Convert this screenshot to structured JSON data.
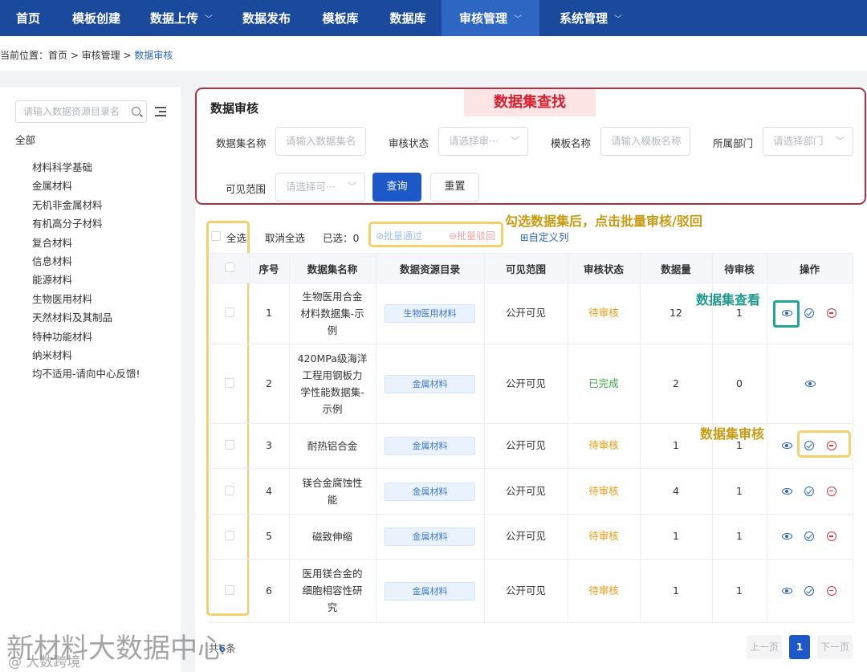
{
  "nav": {
    "items": [
      {
        "label": "首页",
        "chevron": false,
        "active": false
      },
      {
        "label": "模板创建",
        "chevron": false,
        "active": false
      },
      {
        "label": "数据上传",
        "chevron": true,
        "active": false
      },
      {
        "label": "数据发布",
        "chevron": false,
        "active": false
      },
      {
        "label": "模板库",
        "chevron": false,
        "active": false
      },
      {
        "label": "数据库",
        "chevron": false,
        "active": false
      },
      {
        "label": "审核管理",
        "chevron": true,
        "active": true
      },
      {
        "label": "系统管理",
        "chevron": true,
        "active": false
      }
    ]
  },
  "breadcrumb": {
    "prefix": "当前位置：首页 > 审核管理 > ",
    "current": "数据审核"
  },
  "sidebar": {
    "search_placeholder": "请输入数据资源目录名",
    "root": "全部",
    "items": [
      "材料科学基础",
      "金属材料",
      "无机非金属材料",
      "有机高分子材料",
      "复合材料",
      "信息材料",
      "能源材料",
      "生物医用材料",
      "天然材料及其制品",
      "特种功能材料",
      "纳米材料",
      "均不适用-请向中心反馈!"
    ]
  },
  "search": {
    "title": "数据审核",
    "banner": "数据集查找",
    "dataset_label": "数据集名称",
    "dataset_placeholder": "请输入数据集名",
    "status_label": "审核状态",
    "status_placeholder": "请选择审···",
    "template_label": "模板名称",
    "template_placeholder": "请输入模板名称",
    "dept_label": "所属部门",
    "dept_placeholder": "请选择部门",
    "scope_label": "可见范围",
    "scope_placeholder": "请选择可···",
    "query_label": "查询",
    "reset_label": "重置"
  },
  "toolbar": {
    "select_all": "全选",
    "deselect_all": "取消全选",
    "selected": "已选：0",
    "batch_approve": "⊘批量通过",
    "batch_reject": "⊖批量驳回",
    "custom_cols": "⊞自定义列"
  },
  "annotations": {
    "batch_hint": "勾选数据集后，点击批量审核/驳回",
    "view_hint": "数据集查看",
    "review_hint": "数据集审核"
  },
  "table": {
    "headers": [
      "序号",
      "数据集名称",
      "数据资源目录",
      "可见范围",
      "审核状态",
      "数据量",
      "待审核",
      "操作"
    ],
    "rows": [
      {
        "no": "1",
        "name": "生物医用合金材料数据集-示例",
        "name_lines": [
          "生物医用合金",
          "材料数据集-示",
          "例"
        ],
        "dir": "生物医用材料",
        "scope": "公开可见",
        "status": "待审核",
        "count": "12",
        "pending": "1",
        "actions": [
          "view",
          "approve",
          "reject"
        ]
      },
      {
        "no": "2",
        "name": "420MPa级海洋工程用钢板力学性能数据集-示例",
        "name_lines": [
          "420MPa级海洋",
          "工程用钢板力",
          "学性能数据集-",
          "示例"
        ],
        "dir": "金属材料",
        "scope": "公开可见",
        "status": "已完成",
        "count": "2",
        "pending": "0",
        "actions": [
          "view"
        ]
      },
      {
        "no": "3",
        "name": "耐热铝合金",
        "name_lines": [
          "耐热铝合金"
        ],
        "dir": "金属材料",
        "scope": "公开可见",
        "status": "待审核",
        "count": "1",
        "pending": "1",
        "actions": [
          "view",
          "approve",
          "reject"
        ]
      },
      {
        "no": "4",
        "name": "镁合金腐蚀性能",
        "name_lines": [
          "镁合金腐蚀性",
          "能"
        ],
        "dir": "金属材料",
        "scope": "公开可见",
        "status": "待审核",
        "count": "4",
        "pending": "1",
        "actions": [
          "view",
          "approve",
          "reject"
        ]
      },
      {
        "no": "5",
        "name": "磁致伸缩",
        "name_lines": [
          "磁致伸缩"
        ],
        "dir": "金属材料",
        "scope": "公开可见",
        "status": "待审核",
        "count": "1",
        "pending": "1",
        "actions": [
          "view",
          "approve",
          "reject"
        ]
      },
      {
        "no": "6",
        "name": "医用镁合金的细胞相容性研究",
        "name_lines": [
          "医用镁合金的",
          "细胞相容性研",
          "究"
        ],
        "dir": "金属材料",
        "scope": "公开可见",
        "status": "待审核",
        "count": "1",
        "pending": "1",
        "actions": [
          "view",
          "approve",
          "reject"
        ]
      }
    ]
  },
  "pagination": {
    "total_prefix": "共",
    "total": "6",
    "total_suffix": "条",
    "prev": "上一页",
    "current": "1",
    "next": "下一页"
  },
  "watermark": {
    "main": "新材料大数据中心",
    "sub": "@ 大数跨境"
  },
  "colors": {
    "nav_bg": "#1b4a9c",
    "nav_active": "#2e66c4",
    "primary": "#1d58c8",
    "pending": "#f29b12",
    "done": "#3ca847",
    "reject": "#d9363e",
    "banner_red": "#d62030",
    "annotation_yellow": "#f3d16a",
    "annotation_teal": "#22a69a"
  }
}
